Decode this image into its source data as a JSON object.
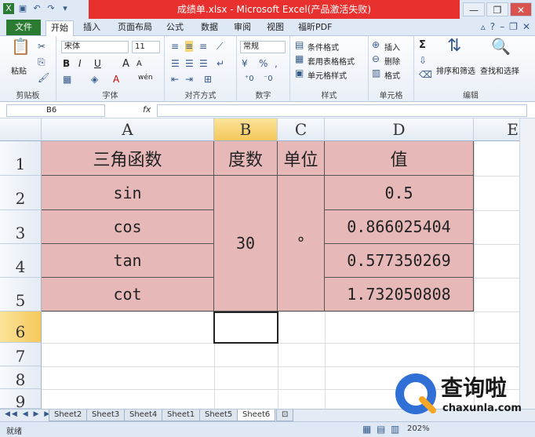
{
  "window": {
    "title": "成绩单.xlsx - Microsoft Excel(产品激活失败)"
  },
  "tabs": {
    "file": "文件",
    "items": [
      "开始",
      "插入",
      "页面布局",
      "公式",
      "数据",
      "审阅",
      "视图",
      "福昕PDF"
    ],
    "active": "开始"
  },
  "ribbon": {
    "clipboard": {
      "label": "剪贴板",
      "paste": "粘贴"
    },
    "font": {
      "label": "字体",
      "name": "宋体",
      "size": "11",
      "bold": "B",
      "italic": "I",
      "underline": "U",
      "grow": "A",
      "shrink": "A",
      "wen": "wén"
    },
    "alignment": {
      "label": "对齐方式"
    },
    "number": {
      "label": "数字",
      "format": "常规"
    },
    "styles": {
      "label": "样式",
      "conditional": "条件格式",
      "table": "套用表格格式",
      "cell": "单元格样式"
    },
    "cells": {
      "label": "单元格",
      "insert": "插入",
      "delete": "删除",
      "format": "格式"
    },
    "editing": {
      "label": "编辑",
      "sort": "排序和筛选",
      "find": "查找和选择",
      "sigma": "Σ"
    }
  },
  "formula_bar": {
    "name_box": "B6",
    "fx": "fx",
    "value": ""
  },
  "grid": {
    "columns": [
      "A",
      "B",
      "C",
      "D",
      "E"
    ],
    "rows": [
      "1",
      "2",
      "3",
      "4",
      "5",
      "6",
      "7",
      "8",
      "9"
    ],
    "header": {
      "a": "三角函数",
      "b": "度数",
      "c": "单位",
      "d": "值"
    },
    "functions": [
      "sin",
      "cos",
      "tan",
      "cot"
    ],
    "degrees": "30",
    "unit": "°",
    "values": [
      "0.5",
      "0.866025404",
      "0.577350269",
      "1.732050808"
    ]
  },
  "sheets": {
    "nav": "◀◀ ◀ ▶ ▶▶",
    "items": [
      "Sheet2",
      "Sheet3",
      "Sheet4",
      "Sheet1",
      "Sheet5",
      "Sheet6"
    ],
    "active": "Sheet6"
  },
  "status": {
    "ready": "就绪",
    "zoom": "202%"
  },
  "watermark": {
    "brand": "查询啦",
    "url": "chaxunla.com"
  },
  "colors": {
    "accent_red": "#e8302f",
    "cell_fill": "#e6b9b8",
    "selected_header": "#f5c85a",
    "file_tab": "#2a7a32"
  }
}
